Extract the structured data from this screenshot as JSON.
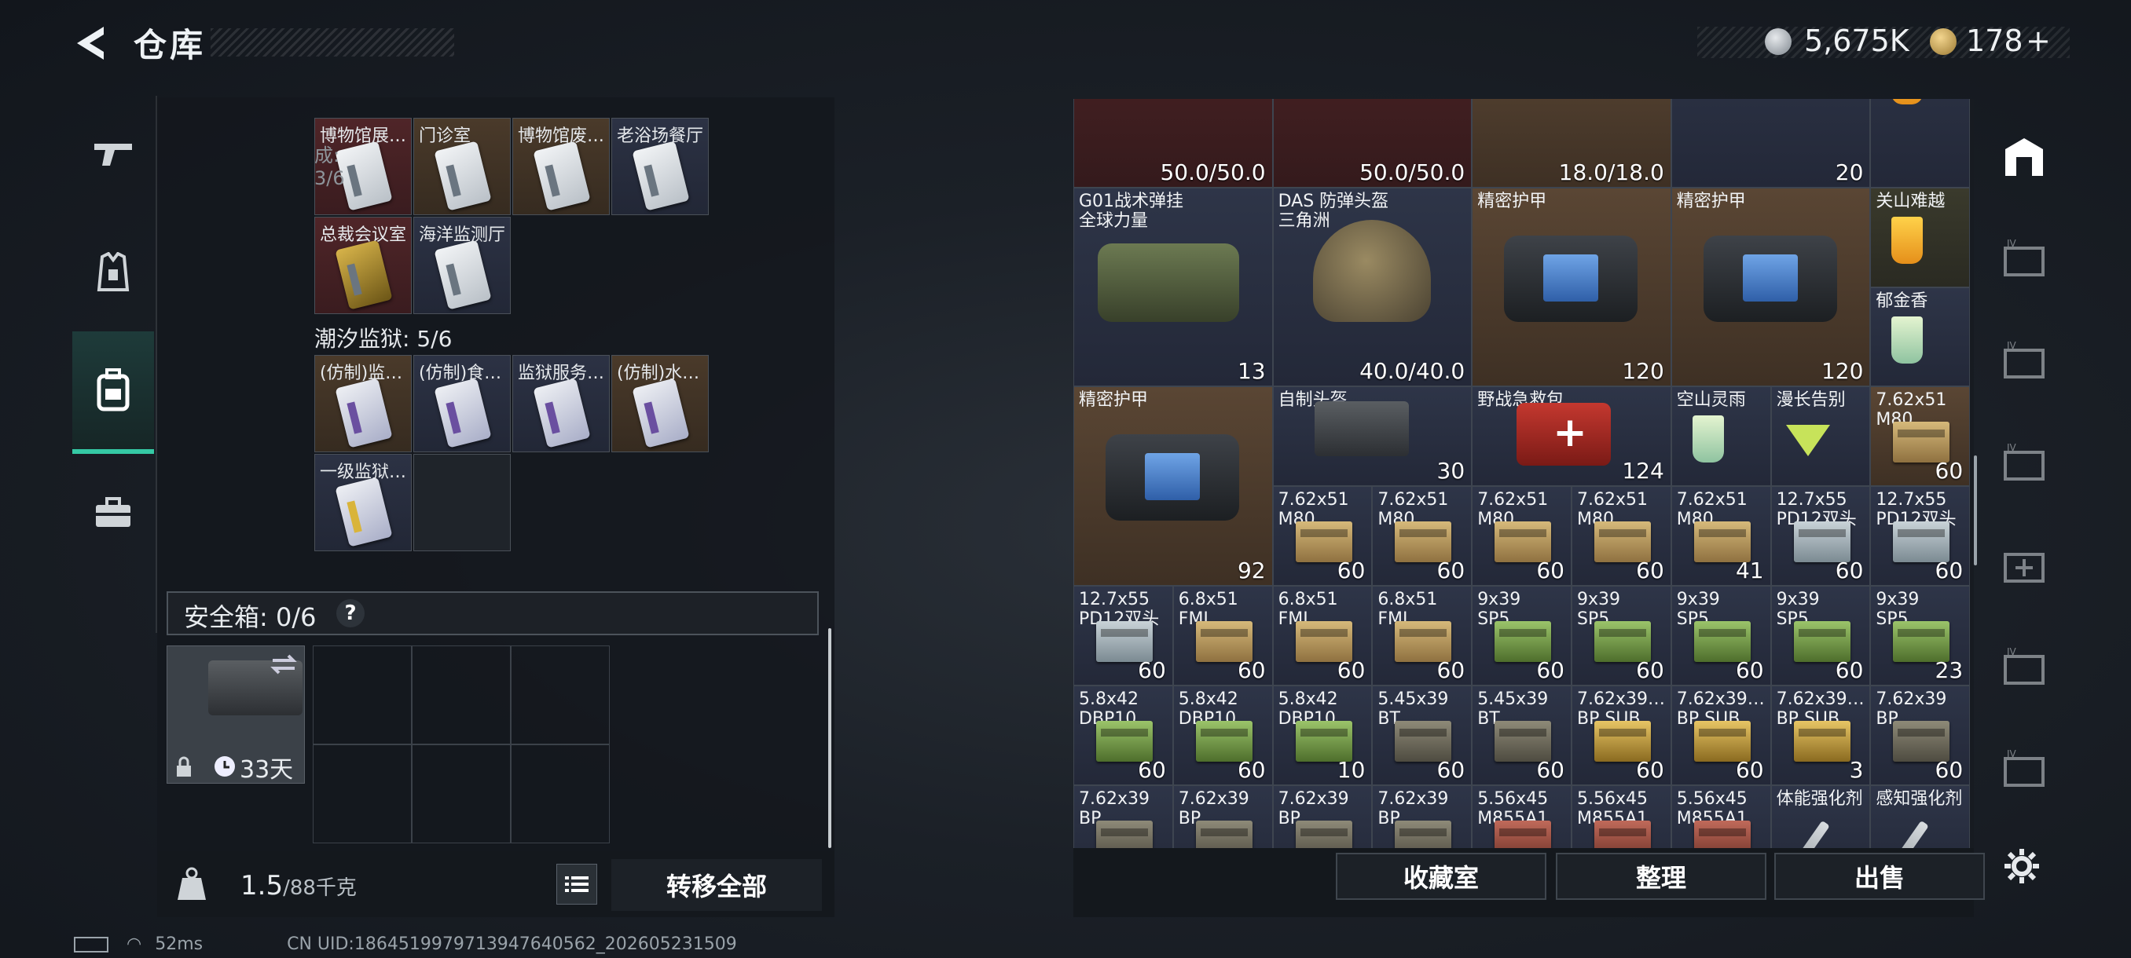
{
  "header": {
    "title": "仓库",
    "currency_silver": "5,675K",
    "currency_gold": "178",
    "add_label": "+"
  },
  "left_panel": {
    "section_partial_label": "已完成: 3/6",
    "row1_cards": [
      {
        "label": "博物馆展…",
        "bg": "red"
      },
      {
        "label": "门诊室",
        "bg": "brown"
      },
      {
        "label": "博物馆废…",
        "bg": "brown"
      },
      {
        "label": "老浴场餐厅",
        "bg": "navy"
      }
    ],
    "row2_cards": [
      {
        "label": "总裁会议室",
        "bg": "red",
        "gold": true
      },
      {
        "label": "海洋监测厅",
        "bg": "navy"
      }
    ],
    "section2_label": "潮汐监狱: 5/6",
    "row3_cards": [
      {
        "label": "(仿制)监…",
        "bg": "brown"
      },
      {
        "label": "(仿制)食…",
        "bg": "navy"
      },
      {
        "label": "监狱服务…",
        "bg": "navy"
      },
      {
        "label": "(仿制)水…",
        "bg": "brown"
      }
    ],
    "row4_cards": [
      {
        "label": "一级监狱…",
        "bg": "navy"
      }
    ],
    "safebox_label": "安全箱: 0/6",
    "safebox_help": "?",
    "safecase_days": "33天",
    "weight_current": "1.5",
    "weight_max": "/88千克",
    "transfer_all": "转移全部"
  },
  "right_panel": {
    "top_row": [
      {
        "count": "50.0/50.0"
      },
      {
        "count": "50.0/50.0"
      },
      {
        "count": "18.0/18.0"
      },
      {
        "count": "20"
      }
    ],
    "items": [
      {
        "id": "g01",
        "label": "G01战术弹挂\n全球力量",
        "count": "13"
      },
      {
        "id": "das",
        "label": "DAS 防弹头盔\n三角洲",
        "count": "40.0/40.0"
      },
      {
        "id": "armor1",
        "label": "精密护甲",
        "count": "120"
      },
      {
        "id": "armor2",
        "label": "精密护甲",
        "count": "120"
      },
      {
        "id": "drink1",
        "label": "关山难越",
        "count": ""
      },
      {
        "id": "drink2",
        "label": "郁金香",
        "count": ""
      },
      {
        "id": "armor3",
        "label": "精密护甲",
        "count": "92"
      },
      {
        "id": "helmet2",
        "label": "自制头盔",
        "count": "30"
      },
      {
        "id": "medkit",
        "label": "野战急救包",
        "count": "124"
      },
      {
        "id": "drink3",
        "label": "空山灵雨",
        "count": ""
      },
      {
        "id": "drink4",
        "label": "漫长告别",
        "count": ""
      },
      {
        "id": "ammo0",
        "label": "7.62x51\nM80",
        "count": "60"
      }
    ],
    "ammo_rows": [
      [
        {
          "label": "7.62x51\nM80",
          "count": "60",
          "color": "tan"
        },
        {
          "label": "7.62x51\nM80",
          "count": "60",
          "color": "tan"
        },
        {
          "label": "7.62x51\nM80",
          "count": "60",
          "color": "tan"
        },
        {
          "label": "7.62x51\nM80",
          "count": "60",
          "color": "tan"
        },
        {
          "label": "7.62x51\nM80",
          "count": "41",
          "color": "tan"
        },
        {
          "label": "12.7x55\nPD12双头",
          "count": "60",
          "color": "bluegrey"
        },
        {
          "label": "12.7x55\nPD12双头",
          "count": "60",
          "color": "bluegrey"
        }
      ],
      [
        {
          "label": "12.7x55\nPD12双头",
          "count": "60",
          "color": "bluegrey"
        },
        {
          "label": "6.8x51\nFMJ",
          "count": "60",
          "color": "tan"
        },
        {
          "label": "6.8x51\nFMJ",
          "count": "60",
          "color": "tan"
        },
        {
          "label": "6.8x51\nFMJ",
          "count": "60",
          "color": "tan"
        },
        {
          "label": "9x39\nSP5",
          "count": "60",
          "color": "green"
        },
        {
          "label": "9x39\nSP5",
          "count": "60",
          "color": "green"
        },
        {
          "label": "9x39\nSP5",
          "count": "60",
          "color": "green"
        },
        {
          "label": "9x39\nSP5",
          "count": "60",
          "color": "green"
        },
        {
          "label": "9x39\nSP5",
          "count": "23",
          "color": "green"
        }
      ],
      [
        {
          "label": "5.8x42\nDBP10",
          "count": "60",
          "color": "green"
        },
        {
          "label": "5.8x42\nDBP10",
          "count": "60",
          "color": "green"
        },
        {
          "label": "5.8x42\nDBP10",
          "count": "10",
          "color": "green"
        },
        {
          "label": "5.45x39\nBT",
          "count": "60",
          "color": "dark"
        },
        {
          "label": "5.45x39\nBT",
          "count": "60",
          "color": "dark"
        },
        {
          "label": "7.62x39…\nBP SUB",
          "count": "60",
          "color": "brass"
        },
        {
          "label": "7.62x39…\nBP SUB",
          "count": "60",
          "color": "brass"
        },
        {
          "label": "7.62x39…\nBP SUB",
          "count": "3",
          "color": "brass"
        },
        {
          "label": "7.62x39\nBP",
          "count": "60",
          "color": "dark"
        }
      ],
      [
        {
          "label": "7.62x39\nBP",
          "count": "",
          "color": "dark"
        },
        {
          "label": "7.62x39\nBP",
          "count": "",
          "color": "dark"
        },
        {
          "label": "7.62x39\nBP",
          "count": "",
          "color": "dark"
        },
        {
          "label": "7.62x39\nBP",
          "count": "",
          "color": "dark"
        },
        {
          "label": "5.56x45\nM855A1",
          "count": "",
          "color": "red"
        },
        {
          "label": "5.56x45\nM855A1",
          "count": "",
          "color": "red"
        },
        {
          "label": "5.56x45\nM855A1",
          "count": "",
          "color": "red"
        },
        {
          "label": "体能强化剂",
          "count": "",
          "color": "syringe"
        },
        {
          "label": "感知强化剂",
          "count": "",
          "color": "syringe"
        }
      ]
    ],
    "buttons": {
      "collection": "收藏室",
      "sort": "整理",
      "sell": "出售"
    }
  },
  "status": {
    "ping": "52ms",
    "uid": "CN UID:1864519979713947640562_202605231509"
  },
  "colors": {
    "accent": "#35c9a5",
    "bg": "#1b2027"
  }
}
